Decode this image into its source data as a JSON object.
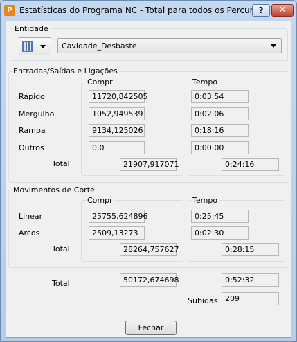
{
  "window": {
    "title": "Estatísticas do Programa NC - Total para todos os Percursos",
    "app_icon_letter": "P",
    "help_label": "?",
    "close_label": "✕"
  },
  "entity": {
    "label": "Entidade",
    "selected": "Cavidade_Desbaste"
  },
  "links": {
    "title": "Entradas/Saídas e Ligações",
    "length_header": "Compr",
    "time_header": "Tempo",
    "rows": [
      {
        "label": "Rápido",
        "length": "11720,842505",
        "time": "0:03:54"
      },
      {
        "label": "Mergulho",
        "length": "1052,949539",
        "time": "0:02:06"
      },
      {
        "label": "Rampa",
        "length": "9134,125026",
        "time": "0:18:16"
      },
      {
        "label": "Outros",
        "length": "0,0",
        "time": "0:00:00"
      }
    ],
    "total_label": "Total",
    "total_length": "21907,917071",
    "total_time": "0:24:16"
  },
  "cutting": {
    "title": "Movimentos de Corte",
    "length_header": "Compr",
    "time_header": "Tempo",
    "rows": [
      {
        "label": "Linear",
        "length": "25755,624896",
        "time": "0:25:45"
      },
      {
        "label": "Arcos",
        "length": "2509,13273",
        "time": "0:02:30"
      }
    ],
    "total_label": "Total",
    "total_length": "28264,757627",
    "total_time": "0:28:15"
  },
  "grand_total": {
    "label": "Total",
    "length": "50172,674698",
    "time": "0:52:32",
    "lifts_label": "Subidas",
    "lifts": "209"
  },
  "close_button": "Fechar"
}
